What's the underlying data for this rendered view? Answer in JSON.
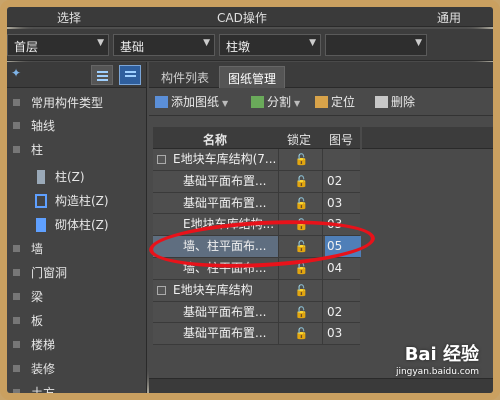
{
  "topbar": {
    "items": [
      "选择",
      "CAD操作",
      "通用"
    ]
  },
  "toolbar": {
    "combos": [
      "首层",
      "基础",
      "柱墩",
      ""
    ]
  },
  "left": {
    "items": [
      {
        "label": "常用构件类型",
        "level": 0
      },
      {
        "label": "轴线",
        "level": 0
      },
      {
        "label": "柱",
        "level": 0
      },
      {
        "label": "柱(Z)",
        "level": 1,
        "icon": "column-icon"
      },
      {
        "label": "构造柱(Z)",
        "level": 1,
        "icon": "constructional-column-icon"
      },
      {
        "label": "砌体柱(Z)",
        "level": 1,
        "icon": "masonry-column-icon"
      },
      {
        "label": "墙",
        "level": 0
      },
      {
        "label": "门窗洞",
        "level": 0
      },
      {
        "label": "梁",
        "level": 0
      },
      {
        "label": "板",
        "level": 0
      },
      {
        "label": "楼梯",
        "level": 0
      },
      {
        "label": "装修",
        "level": 0
      },
      {
        "label": "土方",
        "level": 0
      }
    ]
  },
  "tabs": [
    "构件列表",
    "图纸管理"
  ],
  "actions": {
    "add": "添加图纸",
    "split": "分割",
    "locate": "定位",
    "delete": "删除"
  },
  "grid": {
    "headers": {
      "name": "名称",
      "lock": "锁定",
      "num": "图号"
    },
    "rows": [
      {
        "name": "E地块车库结构(7...",
        "num": "",
        "group": true
      },
      {
        "name": "基础平面布置...",
        "num": "02",
        "group": false
      },
      {
        "name": "基础平面布置...",
        "num": "03",
        "group": false
      },
      {
        "name": "E地块车库结构...",
        "num": "03",
        "group": false
      },
      {
        "name": "墙、柱平面布...",
        "num": "05",
        "group": false,
        "selected": true
      },
      {
        "name": "墙、柱平面布...",
        "num": "04",
        "group": false
      },
      {
        "name": "E地块车库结构",
        "num": "",
        "group": true
      },
      {
        "name": "基础平面布置...",
        "num": "02",
        "group": false
      },
      {
        "name": "基础平面布置...",
        "num": "03",
        "group": false
      }
    ]
  },
  "watermark": {
    "brand": "Bai 经验",
    "url": "jingyan.baidu.com"
  },
  "colors": {
    "highlight": "#e8121a",
    "selection": "#4f7fb8",
    "frame": "#caa060"
  }
}
